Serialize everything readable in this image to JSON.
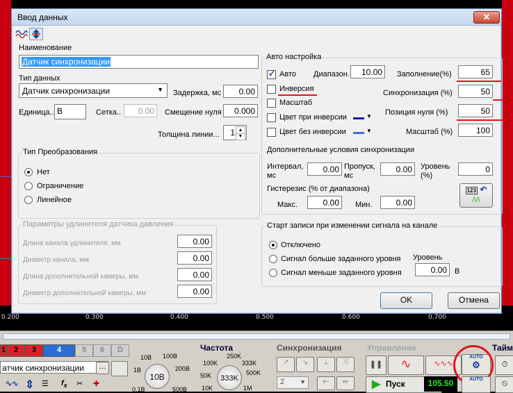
{
  "dialog": {
    "title": "Ввод данных",
    "close_glyph": "✕",
    "name_label": "Наименование",
    "name_value": "Датчик синхронизации",
    "type_label": "Тип данных",
    "type_value": "Датчик синхронизации",
    "delay_label": "Задержка, мс",
    "delay_value": "0.00",
    "unit_label": "Единица..",
    "unit_value": "В",
    "grid_label": "Сетка..",
    "grid_value": "0.00",
    "zero_offset_label": "Смещение нуля",
    "zero_offset_value": "0.000",
    "line_width_label": "Толщина линии...",
    "line_width_value": "1",
    "conversion": {
      "title": "Тип Преобразования",
      "options": [
        "Нет",
        "Ограничение",
        "Линейное"
      ],
      "selected": "Нет"
    },
    "extender": {
      "title": "Параметры удлинителя датчика давления",
      "rows": [
        {
          "label": "Длина канала удлинителя, мм",
          "value": "0.00"
        },
        {
          "label": "Диаметр канала, мм",
          "value": "0.00"
        },
        {
          "label": "Длина дополнительной камеры, мм",
          "value": "0.00"
        },
        {
          "label": "Диаметр дополнительной камеры, мм",
          "value": "0.00"
        }
      ]
    },
    "auto": {
      "title": "Авто настройка",
      "auto_label": "Авто",
      "auto_checked": true,
      "range_label": "Диапазон.",
      "range_value": "10.00",
      "inversion_label": "Инверсия",
      "scale_label": "Масштаб",
      "color_inv_label": "Цвет при инверсии",
      "color_noinv_label": "Цвет без инверсии",
      "fill_label": "Заполнение(%)",
      "fill_value": "65",
      "sync_label": "Синхронизация (%)",
      "sync_value": "50",
      "zero_pos_label": "Позиция нуля (%)",
      "zero_pos_value": "50",
      "scale_pct_label": "Масштаб (%)",
      "scale_pct_value": "100"
    },
    "sync_extra": {
      "title": "Дополнительные условия синхронизации",
      "interval_label_1": "Интервал,",
      "interval_label_2": "мс",
      "interval_value": "0.00",
      "skip_label_1": "Пропуск,",
      "skip_label_2": "мс",
      "skip_value": "0.00",
      "level_label_1": "Уровень",
      "level_label_2": "(%)",
      "level_value": "0",
      "hyst_label": "Гистерезис (% от диапазона)",
      "max_label": "Макс.",
      "max_value": "0.00",
      "min_label": "Мин.",
      "min_value": "0.00",
      "icon_text": "123"
    },
    "record": {
      "title": "Старт записи при изменении сигнала на канале",
      "options": [
        "Отключено",
        "Сигнал больше заданного уровня",
        "Сигнал меньше заданного уровня"
      ],
      "selected": "Отключено",
      "level_label": "Уровень",
      "level_value": "0.00",
      "level_unit": "В"
    },
    "ok_label": "OK",
    "cancel_label": "Отмена"
  },
  "background": {
    "axis_ticks": [
      "0.200",
      "0.300",
      "0.400",
      "0.500",
      "0.600",
      "0.700"
    ],
    "channel_tabs": [
      "1",
      "2",
      "3",
      "4",
      "5",
      "6",
      "D"
    ],
    "channel_name": "атчик синхронизации",
    "voltage_title": "",
    "voltage_labels": [
      "10В",
      "100В",
      "1В",
      "200В",
      "0.1В",
      "500В"
    ],
    "voltage_knob": "10В",
    "freq_title": "Частота",
    "freq_labels": [
      "250K",
      "100K",
      "333K",
      "50K",
      "500K",
      "10K",
      "1M"
    ],
    "freq_knob": "333K",
    "sync_title": "Синхронизация",
    "sync_select": "2",
    "control_title": "Управление",
    "start_label": "Пуск",
    "value_display": "105.50",
    "timer_title": "Тайм",
    "auto_badge": "AUTO",
    "colors": {
      "accent_red": "#e3131b",
      "tab_active": "#2b6fd6",
      "tab_red": "#d9232b",
      "play_green": "#1faa1f"
    }
  }
}
